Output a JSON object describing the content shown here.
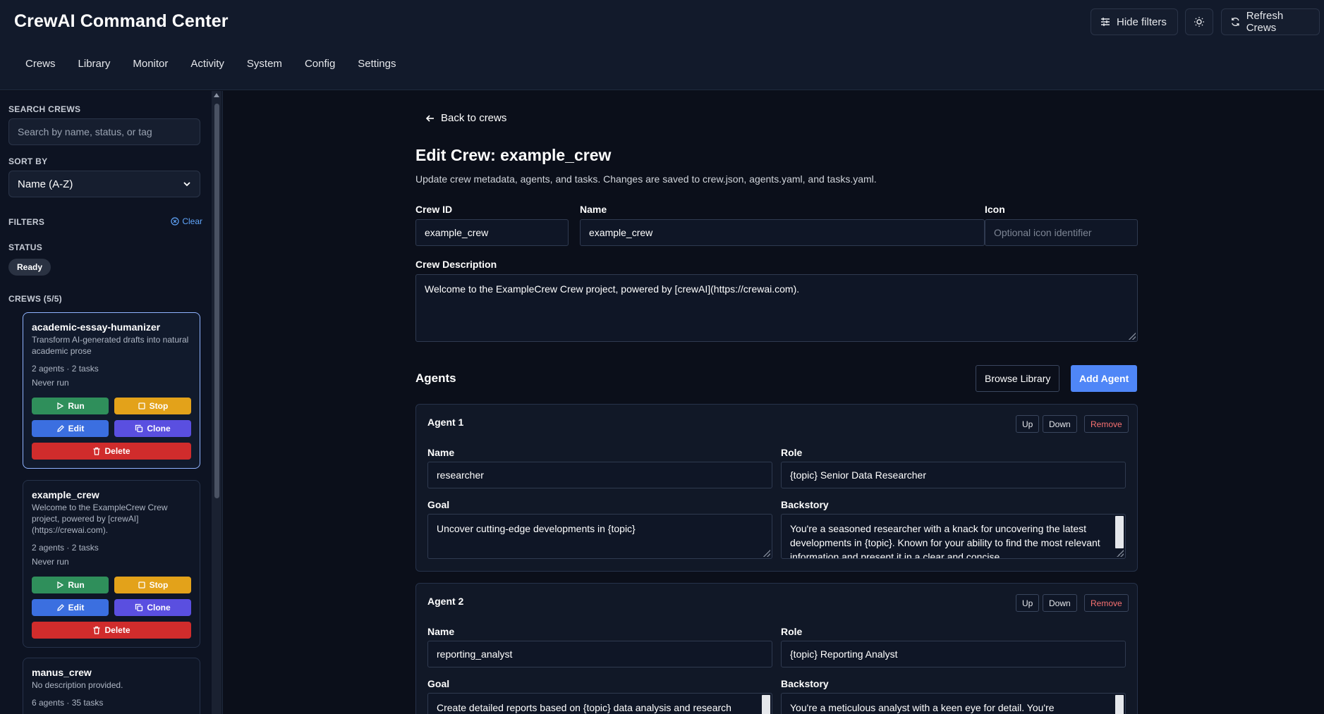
{
  "app": {
    "title": "CrewAI Command Center"
  },
  "nav": [
    "Crews",
    "Library",
    "Monitor",
    "Activity",
    "System",
    "Config",
    "Settings"
  ],
  "header_buttons": {
    "hide_filters": "Hide filters",
    "refresh": "Refresh Crews"
  },
  "sidebar": {
    "search_label": "SEARCH CREWS",
    "search_placeholder": "Search by name, status, or tag",
    "sort_label": "SORT BY",
    "sort_value": "Name (A-Z)",
    "filters_label": "FILTERS",
    "clear_label": "Clear",
    "status_label": "STATUS",
    "status_chip": "Ready",
    "crews_label": "CREWS (5/5)",
    "crews": [
      {
        "name": "academic-essay-humanizer",
        "desc": "Transform AI-generated drafts into natural academic prose",
        "meta": "2 agents · 2 tasks",
        "run_state": "Never run"
      },
      {
        "name": "example_crew",
        "desc": "Welcome to the ExampleCrew Crew project, powered by [crewAI] (https://crewai.com).",
        "meta": "2 agents · 2 tasks",
        "run_state": "Never run"
      },
      {
        "name": "manus_crew",
        "desc": "No description provided.",
        "meta": "6 agents · 35 tasks",
        "run_state": ""
      }
    ],
    "crew_buttons": {
      "run": "Run",
      "stop": "Stop",
      "edit": "Edit",
      "clone": "Clone",
      "delete": "Delete"
    }
  },
  "main": {
    "back": "Back to crews",
    "title": "Edit Crew: example_crew",
    "subtitle": "Update crew metadata, agents, and tasks. Changes are saved to crew.json, agents.yaml, and tasks.yaml.",
    "crew_id_label": "Crew ID",
    "crew_id_value": "example_crew",
    "name_label": "Name",
    "name_value": "example_crew",
    "icon_label": "Icon",
    "icon_placeholder": "Optional icon identifier",
    "desc_label": "Crew Description",
    "desc_value": "Welcome to the ExampleCrew Crew project, powered by [crewAI](https://crewai.com).",
    "agents_title": "Agents",
    "browse_library": "Browse Library",
    "add_agent": "Add Agent",
    "agent_buttons": {
      "up": "Up",
      "down": "Down",
      "remove": "Remove"
    },
    "field_labels": {
      "name": "Name",
      "role": "Role",
      "goal": "Goal",
      "backstory": "Backstory"
    },
    "agents": [
      {
        "title": "Agent 1",
        "name": "researcher",
        "role": "{topic} Senior Data Researcher",
        "goal": "Uncover cutting-edge developments in {topic}",
        "backstory": "You're a seasoned researcher with a knack for uncovering the latest developments in {topic}. Known for your ability to find the most relevant information and present it in a clear and concise"
      },
      {
        "title": "Agent 2",
        "name": "reporting_analyst",
        "role": "{topic} Reporting Analyst",
        "goal": "Create detailed reports based on {topic} data analysis and research",
        "backstory": "You're a meticulous analyst with a keen eye for detail. You're"
      }
    ]
  }
}
